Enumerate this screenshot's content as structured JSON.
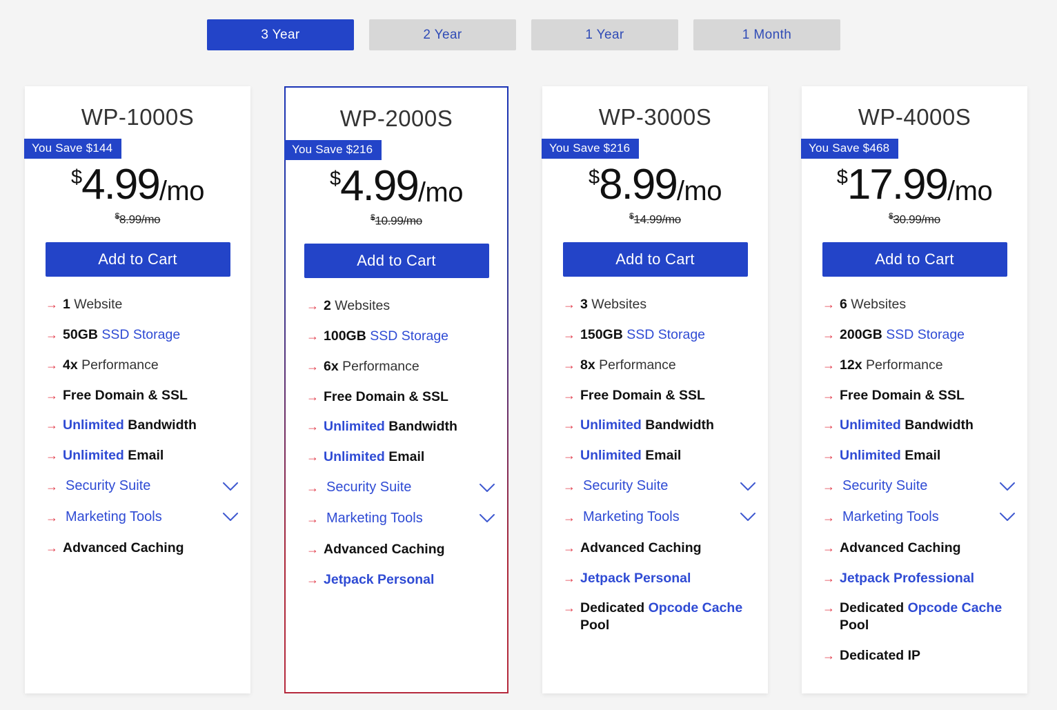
{
  "colors": {
    "accent_blue": "#2344c8",
    "link_blue": "#2f4bd4",
    "arrow_red": "#e23b4a",
    "page_bg": "#f4f4f4",
    "tab_inactive_bg": "#d7d7d7",
    "featured_border_top": "#1a33b5",
    "featured_border_bottom": "#b5293c"
  },
  "term_toggle": {
    "options": [
      {
        "label": "3 Year",
        "active": true
      },
      {
        "label": "2 Year",
        "active": false
      },
      {
        "label": "1 Year",
        "active": false
      },
      {
        "label": "1 Month",
        "active": false
      }
    ]
  },
  "plans": [
    {
      "name": "WP-1000S",
      "save_badge": "You Save $144",
      "currency": "$",
      "price": "4.99",
      "period": "/mo",
      "old_currency": "$",
      "old_price": "8.99/mo",
      "cta": "Add to Cart",
      "featured": false,
      "features": [
        {
          "parts": [
            {
              "t": "1",
              "s": "b"
            },
            {
              "t": " Website",
              "s": "n"
            }
          ]
        },
        {
          "parts": [
            {
              "t": "50GB",
              "s": "b"
            },
            {
              "t": " SSD Storage",
              "s": "blue-n"
            }
          ]
        },
        {
          "parts": [
            {
              "t": "4x",
              "s": "b"
            },
            {
              "t": " Performance",
              "s": "n"
            }
          ]
        },
        {
          "parts": [
            {
              "t": "Free Domain & SSL",
              "s": "b"
            }
          ]
        },
        {
          "parts": [
            {
              "t": "Unlimited",
              "s": "blue"
            },
            {
              "t": " Bandwidth",
              "s": "b"
            }
          ]
        },
        {
          "parts": [
            {
              "t": "Unlimited",
              "s": "blue"
            },
            {
              "t": " Email",
              "s": "b"
            }
          ]
        },
        {
          "parts": [
            {
              "t": "Security Suite",
              "s": "blue-n"
            }
          ],
          "expandable": true
        },
        {
          "parts": [
            {
              "t": "Marketing Tools",
              "s": "blue-n"
            }
          ],
          "expandable": true
        },
        {
          "parts": [
            {
              "t": "Advanced Caching",
              "s": "b"
            }
          ]
        }
      ]
    },
    {
      "name": "WP-2000S",
      "save_badge": "You Save $216",
      "currency": "$",
      "price": "4.99",
      "period": "/mo",
      "old_currency": "$",
      "old_price": "10.99/mo",
      "cta": "Add to Cart",
      "featured": true,
      "features": [
        {
          "parts": [
            {
              "t": "2",
              "s": "b"
            },
            {
              "t": " Websites",
              "s": "n"
            }
          ]
        },
        {
          "parts": [
            {
              "t": "100GB",
              "s": "b"
            },
            {
              "t": " SSD Storage",
              "s": "blue-n"
            }
          ]
        },
        {
          "parts": [
            {
              "t": "6x",
              "s": "b"
            },
            {
              "t": " Performance",
              "s": "n"
            }
          ]
        },
        {
          "parts": [
            {
              "t": "Free Domain & SSL",
              "s": "b"
            }
          ]
        },
        {
          "parts": [
            {
              "t": "Unlimited",
              "s": "blue"
            },
            {
              "t": " Bandwidth",
              "s": "b"
            }
          ]
        },
        {
          "parts": [
            {
              "t": "Unlimited",
              "s": "blue"
            },
            {
              "t": " Email",
              "s": "b"
            }
          ]
        },
        {
          "parts": [
            {
              "t": "Security Suite",
              "s": "blue-n"
            }
          ],
          "expandable": true
        },
        {
          "parts": [
            {
              "t": "Marketing Tools",
              "s": "blue-n"
            }
          ],
          "expandable": true
        },
        {
          "parts": [
            {
              "t": "Advanced Caching",
              "s": "b"
            }
          ]
        },
        {
          "parts": [
            {
              "t": "Jetpack Personal",
              "s": "blue"
            }
          ]
        }
      ]
    },
    {
      "name": "WP-3000S",
      "save_badge": "You Save $216",
      "currency": "$",
      "price": "8.99",
      "period": "/mo",
      "old_currency": "$",
      "old_price": "14.99/mo",
      "cta": "Add to Cart",
      "featured": false,
      "features": [
        {
          "parts": [
            {
              "t": "3",
              "s": "b"
            },
            {
              "t": " Websites",
              "s": "n"
            }
          ]
        },
        {
          "parts": [
            {
              "t": "150GB",
              "s": "b"
            },
            {
              "t": " SSD Storage",
              "s": "blue-n"
            }
          ]
        },
        {
          "parts": [
            {
              "t": "8x",
              "s": "b"
            },
            {
              "t": " Performance",
              "s": "n"
            }
          ]
        },
        {
          "parts": [
            {
              "t": "Free Domain & SSL",
              "s": "b"
            }
          ]
        },
        {
          "parts": [
            {
              "t": "Unlimited",
              "s": "blue"
            },
            {
              "t": " Bandwidth",
              "s": "b"
            }
          ]
        },
        {
          "parts": [
            {
              "t": "Unlimited",
              "s": "blue"
            },
            {
              "t": " Email",
              "s": "b"
            }
          ]
        },
        {
          "parts": [
            {
              "t": "Security Suite",
              "s": "blue-n"
            }
          ],
          "expandable": true
        },
        {
          "parts": [
            {
              "t": "Marketing Tools",
              "s": "blue-n"
            }
          ],
          "expandable": true
        },
        {
          "parts": [
            {
              "t": "Advanced Caching",
              "s": "b"
            }
          ]
        },
        {
          "parts": [
            {
              "t": "Jetpack Personal",
              "s": "blue"
            }
          ]
        },
        {
          "parts": [
            {
              "t": "Dedicated ",
              "s": "b"
            },
            {
              "t": "Opcode Cache",
              "s": "blue"
            },
            {
              "t": " Pool",
              "s": "b"
            }
          ]
        }
      ]
    },
    {
      "name": "WP-4000S",
      "save_badge": "You Save $468",
      "currency": "$",
      "price": "17.99",
      "period": "/mo",
      "old_currency": "$",
      "old_price": "30.99/mo",
      "cta": "Add to Cart",
      "featured": false,
      "features": [
        {
          "parts": [
            {
              "t": "6",
              "s": "b"
            },
            {
              "t": " Websites",
              "s": "n"
            }
          ]
        },
        {
          "parts": [
            {
              "t": "200GB",
              "s": "b"
            },
            {
              "t": " SSD Storage",
              "s": "blue-n"
            }
          ]
        },
        {
          "parts": [
            {
              "t": "12x",
              "s": "b"
            },
            {
              "t": " Performance",
              "s": "n"
            }
          ]
        },
        {
          "parts": [
            {
              "t": "Free Domain & SSL",
              "s": "b"
            }
          ]
        },
        {
          "parts": [
            {
              "t": "Unlimited",
              "s": "blue"
            },
            {
              "t": " Bandwidth",
              "s": "b"
            }
          ]
        },
        {
          "parts": [
            {
              "t": "Unlimited",
              "s": "blue"
            },
            {
              "t": " Email",
              "s": "b"
            }
          ]
        },
        {
          "parts": [
            {
              "t": "Security Suite",
              "s": "blue-n"
            }
          ],
          "expandable": true
        },
        {
          "parts": [
            {
              "t": "Marketing Tools",
              "s": "blue-n"
            }
          ],
          "expandable": true
        },
        {
          "parts": [
            {
              "t": "Advanced Caching",
              "s": "b"
            }
          ]
        },
        {
          "parts": [
            {
              "t": "Jetpack Professional",
              "s": "blue"
            }
          ]
        },
        {
          "parts": [
            {
              "t": "Dedicated ",
              "s": "b"
            },
            {
              "t": "Opcode Cache",
              "s": "blue"
            },
            {
              "t": " Pool",
              "s": "b"
            }
          ]
        },
        {
          "parts": [
            {
              "t": "Dedicated IP",
              "s": "b"
            }
          ]
        }
      ]
    }
  ],
  "icons": {
    "arrow": "→",
    "chevron_down": "chevron-down-icon"
  }
}
